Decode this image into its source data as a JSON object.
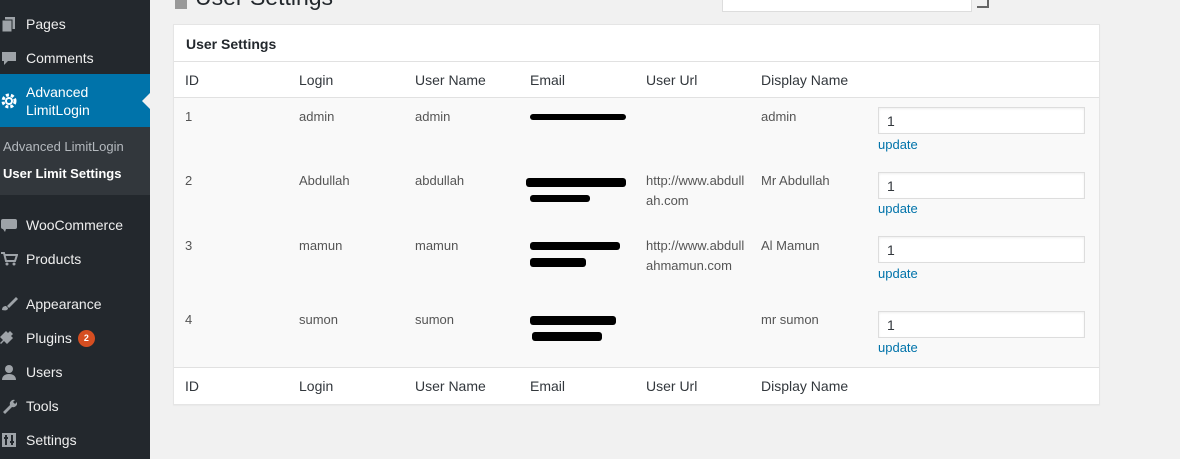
{
  "sidebar": {
    "items": [
      {
        "label": "Pages",
        "icon": "pages-icon"
      },
      {
        "label": "Comments",
        "icon": "comments-icon"
      },
      {
        "label": "Advanced\nLimitLogin",
        "icon": "gear-icon",
        "active": true
      },
      {
        "label": "WooCommerce",
        "icon": "woo-icon"
      },
      {
        "label": "Products",
        "icon": "cart-icon"
      },
      {
        "label": "Appearance",
        "icon": "brush-icon"
      },
      {
        "label": "Plugins",
        "icon": "plugin-icon",
        "badge": "2"
      },
      {
        "label": "Users",
        "icon": "user-icon"
      },
      {
        "label": "Tools",
        "icon": "wrench-icon"
      },
      {
        "label": "Settings",
        "icon": "sliders-icon"
      }
    ],
    "submenu": [
      "Advanced LimitLogin",
      "User Limit Settings"
    ]
  },
  "page": {
    "title": "User Settings"
  },
  "panel": {
    "title": "User Settings",
    "columns": [
      "ID",
      "Login",
      "User Name",
      "Email",
      "User Url",
      "Display Name"
    ],
    "rows": [
      {
        "id": "1",
        "login": "admin",
        "username": "admin",
        "url": "",
        "display": "admin",
        "value": "1",
        "action": "update"
      },
      {
        "id": "2",
        "login": "Abdullah",
        "username": "abdullah",
        "url": "http://www.abdullah.com",
        "display": "Mr Abdullah",
        "value": "1",
        "action": "update"
      },
      {
        "id": "3",
        "login": "mamun",
        "username": "mamun",
        "url": "http://www.abdullahmamun.com",
        "display": "Al Mamun",
        "value": "1",
        "action": "update"
      },
      {
        "id": "4",
        "login": "sumon",
        "username": "sumon",
        "url": "",
        "display": "mr sumon",
        "value": "1",
        "action": "update"
      }
    ]
  },
  "colors": {
    "sidebar": "#23282d",
    "active": "#0073aa",
    "link": "#0073aa",
    "badge": "#d54e21"
  }
}
